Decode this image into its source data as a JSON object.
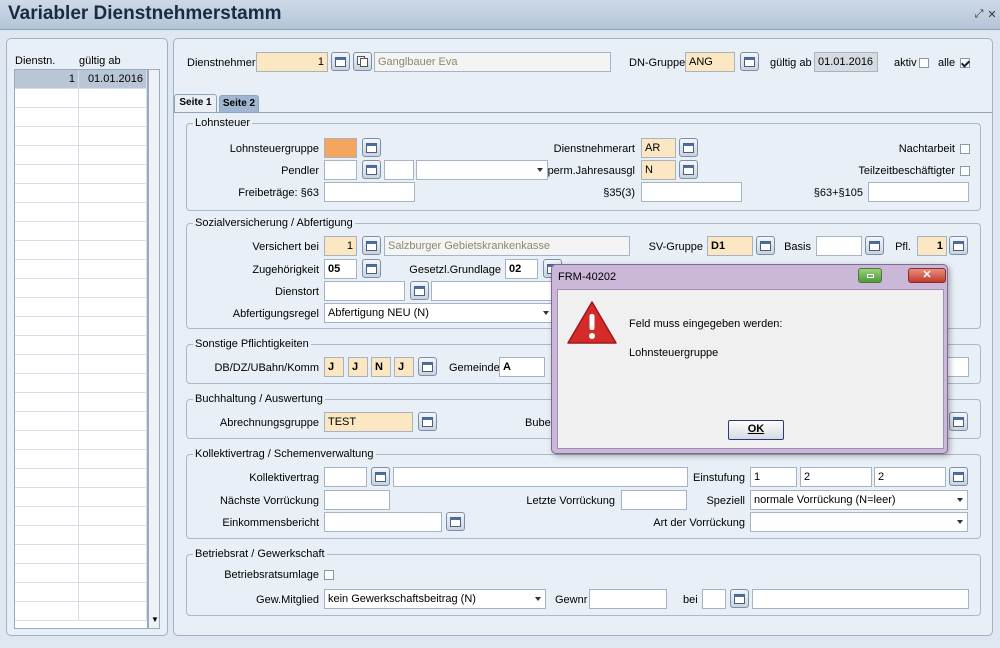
{
  "window": {
    "title": "Variabler Dienstnehmerstamm"
  },
  "list": {
    "headers": [
      "Dienstn.",
      "gültig ab"
    ],
    "rows": [
      {
        "nr": "1",
        "date": "01.01.2016"
      }
    ]
  },
  "header": {
    "dienstnehmer_label": "Dienstnehmer",
    "dienstnehmer_value": "1",
    "name_value": "Ganglbauer Eva",
    "dngruppe_label": "DN-Gruppe",
    "dngruppe_value": "ANG",
    "gueltig_label": "gültig ab",
    "gueltig_value": "01.01.2016",
    "aktiv_label": "aktiv",
    "alle_label": "alle",
    "aktiv_checked": false,
    "alle_checked": true
  },
  "tabs": [
    {
      "label": "Seite 1",
      "active": true
    },
    {
      "label": "Seite 2",
      "active": false
    }
  ],
  "lohnsteuer": {
    "title": "Lohnsteuer",
    "lohnsteuergruppe_label": "Lohnsteuergruppe",
    "pendler_label": "Pendler",
    "freibetraege_label": "Freibeträge: §63",
    "dienstnehmerart_label": "Dienstnehmerart",
    "dienstnehmerart_value": "AR",
    "perm_label": "perm.Jahresausgl",
    "perm_value": "N",
    "s35_label": "§35(3)",
    "nachtarbeit_label": "Nachtarbeit",
    "teilzeit_label": "Teilzeitbeschäftigter",
    "s63_105_label": "§63+§105"
  },
  "sv": {
    "title": "Sozialversicherung / Abfertigung",
    "versichert_label": "Versichert bei",
    "versichert_value": "1",
    "kasse_value": "Salzburger Gebietskrankenkasse",
    "svgruppe_label": "SV-Gruppe",
    "svgruppe_value": "D1",
    "basis_label": "Basis",
    "pfl_label": "Pfl.",
    "pfl_value": "1",
    "zugehoerigkeit_label": "Zugehörigkeit",
    "zugehoerigkeit_value": "05",
    "grundlage_label": "Gesetzl.Grundlage",
    "grundlage_value": "02",
    "dienstort_label": "Dienstort",
    "abfertigung_label": "Abfertigungsregel",
    "abfertigung_value": "Abfertigung NEU (N)"
  },
  "sonstige": {
    "title": "Sonstige Pflichtigkeiten",
    "db_label": "DB/DZ/UBahn/Komm",
    "db_values": [
      "J",
      "J",
      "N",
      "J"
    ],
    "gemeinde_label": "Gemeinde",
    "gemeinde_value": "A"
  },
  "buchhaltung": {
    "title": "Buchhaltung / Auswertung",
    "abrechnungsgruppe_label": "Abrechnungsgruppe",
    "abrechnungsgruppe_value": "TEST",
    "bubei_label": "Bubei"
  },
  "kv": {
    "title": "Kollektivertrag / Schemenverwaltung",
    "kollektivvertrag_label": "Kollektivertrag",
    "einstufung_label": "Einstufung",
    "einstufung_values": [
      "1",
      "2",
      "2"
    ],
    "naechste_label": "Nächste Vorrückung",
    "letzte_label": "Letzte Vorrückung",
    "speziell_label": "Speziell",
    "speziell_value": "normale Vorrückung (N=leer)",
    "einkommen_label": "Einkommensbericht",
    "art_label": "Art der Vorrückung"
  },
  "br": {
    "title": "Betriebsrat / Gewerkschaft",
    "umlage_label": "Betriebsratsumlage",
    "gew_label": "Gew.Mitglied",
    "gew_value": "kein Gewerkschaftsbeitrag (N)",
    "gewnr_label": "Gewnr",
    "bei_label": "bei"
  },
  "dialog": {
    "title": "FRM-40202",
    "message": "Feld muss eingegeben werden:",
    "field": "Lohnsteuergruppe",
    "ok_label": "OK"
  },
  "colors": {
    "required": "#fbe7c2",
    "error_field": "#f5a65e",
    "dialog_frame": "#cbb7d8"
  }
}
